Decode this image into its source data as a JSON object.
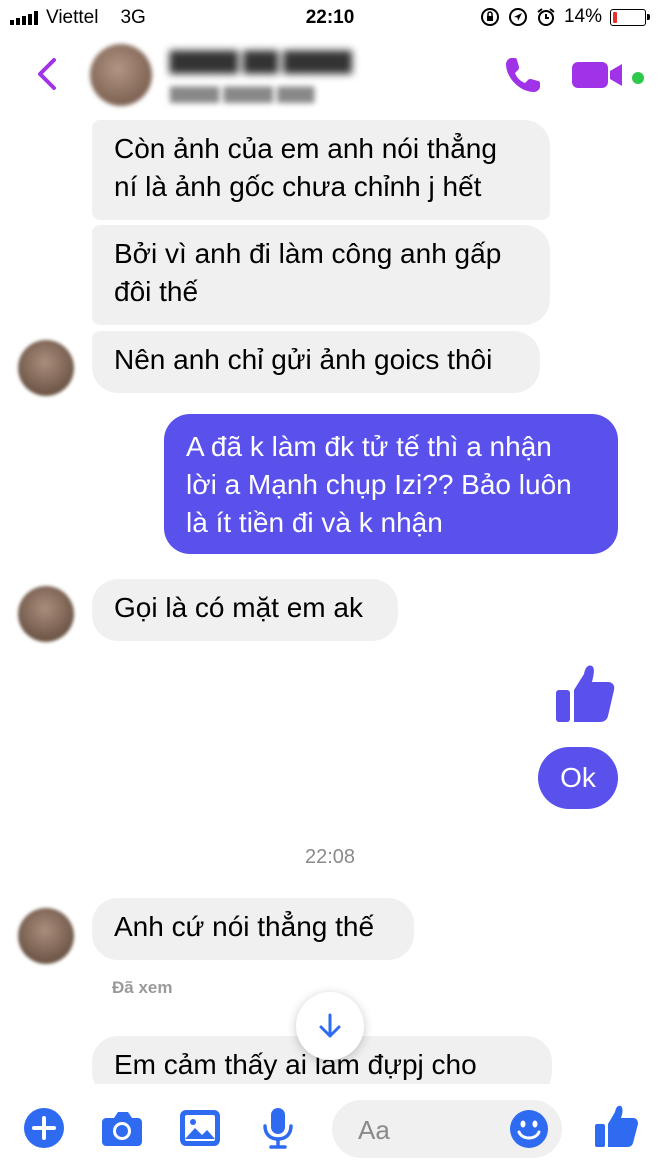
{
  "status_bar": {
    "carrier": "Viettel",
    "network": "3G",
    "time": "22:10",
    "battery": "14%"
  },
  "colors": {
    "accent": "#5a50ec",
    "icon": "#2e6bf0",
    "messenger_purple": "#a033e8",
    "online": "#2ec94c"
  },
  "messages": [
    {
      "sender": "them",
      "lines": [
        "Còn ảnh của em anh nói thẳng",
        "ní là ảnh gốc chưa chỉnh j hết"
      ]
    },
    {
      "sender": "them",
      "lines": [
        "Bởi vì anh đi làm công anh gấp",
        "đôi thế"
      ]
    },
    {
      "sender": "them",
      "lines": [
        "Nên anh chỉ gửi ảnh goics thôi"
      ]
    },
    {
      "sender": "me",
      "lines": [
        "A đã k làm đk tử tế thì a nhận",
        "lời a Mạnh chụp Izi?? Bảo luôn",
        "là ít tiền đi và k nhận"
      ]
    },
    {
      "sender": "them",
      "lines": [
        "Gọi là có mặt em ak"
      ]
    },
    {
      "sender": "me",
      "type": "like",
      "icon": "thumbs-up-icon"
    },
    {
      "sender": "me",
      "lines": [
        "Ok"
      ]
    },
    {
      "sender": "them",
      "lines": [
        "Anh cứ nói thẳng thế"
      ]
    },
    {
      "sender": "them",
      "lines": [
        "Em cảm thấy ai làm đựpj cho"
      ]
    }
  ],
  "timestamp": "22:08",
  "seen_label": "Đã xem",
  "composer": {
    "placeholder": "Aa"
  },
  "icons": [
    "back-icon",
    "phone-icon",
    "video-camera-icon",
    "plus-icon",
    "camera-icon",
    "gallery-icon",
    "microphone-icon",
    "emoji-icon",
    "thumbs-up-icon",
    "arrow-down-icon"
  ]
}
